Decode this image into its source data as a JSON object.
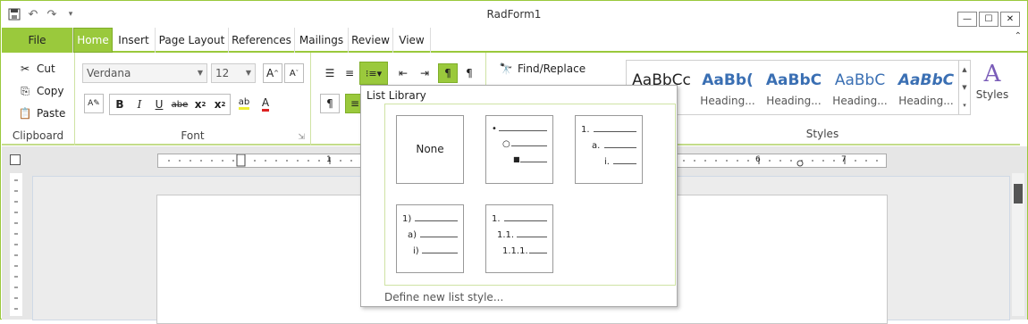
{
  "window": {
    "title": "RadForm1"
  },
  "qat": {
    "save_icon": "save-icon",
    "undo_icon": "undo-icon",
    "redo_icon": "redo-icon",
    "customize_icon": "customize-icon"
  },
  "window_controls": {
    "minimize": "minimize-icon",
    "maximize": "maximize-icon",
    "close": "close-icon"
  },
  "tabs": {
    "file": "File",
    "home": "Home",
    "insert": "Insert",
    "page_layout": "Page Layout",
    "references": "References",
    "mailings": "Mailings",
    "review": "Review",
    "view": "View"
  },
  "clipboard": {
    "cut": "Cut",
    "copy": "Copy",
    "paste": "Paste",
    "label": "Clipboard"
  },
  "font": {
    "family": "Verdana",
    "size": "12",
    "label": "Font",
    "grow": "A",
    "shrink": "A",
    "bold": "B",
    "italic": "I",
    "underline": "U",
    "strike": "abe",
    "subscript": "x",
    "superscript": "x",
    "font_color": "A"
  },
  "editing": {
    "find_replace": "Find/Replace"
  },
  "styles": {
    "label": "Styles",
    "button_label": "Styles",
    "items": [
      {
        "sample": "AaBbCc",
        "name": ""
      },
      {
        "sample": "AaBb(",
        "name": "Heading..."
      },
      {
        "sample": "AaBbC",
        "name": "Heading..."
      },
      {
        "sample": "AaBbC",
        "name": "Heading..."
      },
      {
        "sample": "AaBbC",
        "name": "Heading..."
      }
    ]
  },
  "ruler": {
    "marks": [
      "1",
      "6",
      "7"
    ]
  },
  "list_library": {
    "header": "List Library",
    "none_label": "None",
    "multilevel_numbers": [
      "1.",
      "a.",
      "i."
    ],
    "paren_numbers": [
      "1)",
      "a)",
      "i)"
    ],
    "decimal_numbers": [
      "1.",
      "1.1.",
      "1.1.1."
    ],
    "footer": "Define new list style..."
  },
  "colors": {
    "accent": "#9ac93c",
    "accent_dark": "#7fae2a"
  }
}
